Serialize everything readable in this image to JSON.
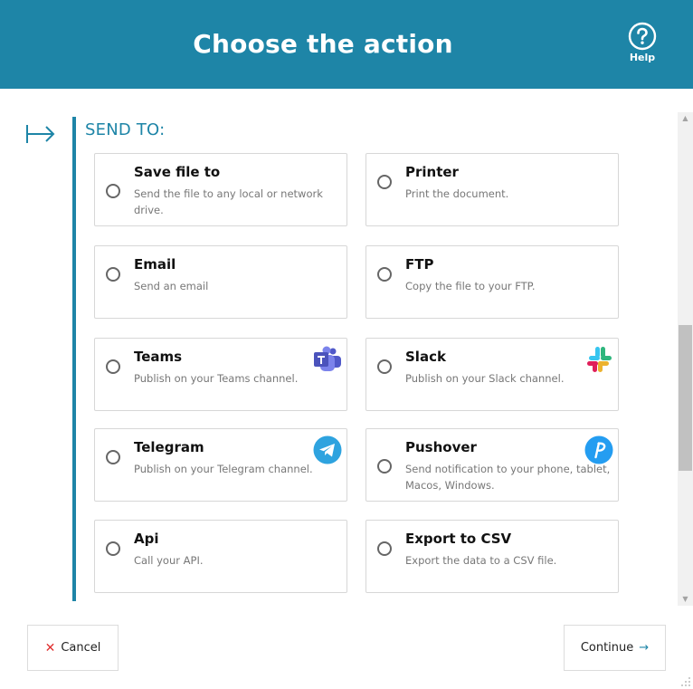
{
  "header": {
    "title": "Choose the action",
    "help_label": "Help"
  },
  "section": {
    "title": "SEND TO:"
  },
  "options": [
    {
      "title": "Save file to",
      "description": "Send the file to any local or network drive.",
      "logo": ""
    },
    {
      "title": "Printer",
      "description": "Print the document.",
      "logo": ""
    },
    {
      "title": "Email",
      "description": "Send an email",
      "logo": ""
    },
    {
      "title": "FTP",
      "description": "Copy the file to your FTP.",
      "logo": ""
    },
    {
      "title": "Teams",
      "description": "Publish on your Teams channel.",
      "logo": "teams-logo-icon"
    },
    {
      "title": "Slack",
      "description": "Publish on your Slack channel.",
      "logo": "slack-logo-icon"
    },
    {
      "title": "Telegram",
      "description": "Publish on your Telegram channel.",
      "logo": "telegram-logo-icon"
    },
    {
      "title": "Pushover",
      "description": "Send notification to your phone, tablet, Macos, Windows.",
      "logo": "pushover-logo-icon"
    },
    {
      "title": "Api",
      "description": "Call your API.",
      "logo": ""
    },
    {
      "title": "Export to CSV",
      "description": "Export the data to a CSV file.",
      "logo": ""
    }
  ],
  "footer": {
    "cancel_label": "Cancel",
    "continue_label": "Continue"
  },
  "colors": {
    "accent": "#1e85a7",
    "cancel_icon": "#e03030"
  }
}
